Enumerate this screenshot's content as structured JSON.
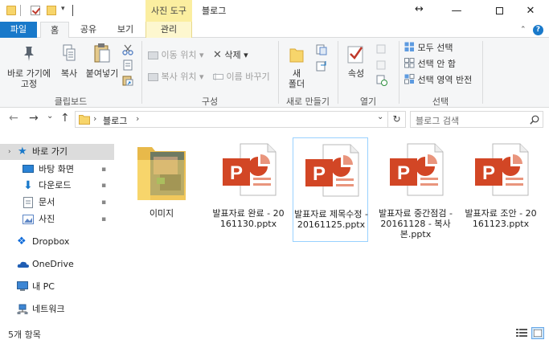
{
  "window": {
    "context_tab_header": "사진 도구",
    "title": "블로그",
    "resize_glyph": "↔",
    "minimize_glyph": "—",
    "close_glyph": "✕",
    "qa_dropdown_glyph": "▾"
  },
  "ribbon_tabs": [
    {
      "label": "파일"
    },
    {
      "label": "홈"
    },
    {
      "label": "공유"
    },
    {
      "label": "보기"
    },
    {
      "label": "관리"
    }
  ],
  "ribbon_collapse_glyph": "⌃",
  "help_glyph": "?",
  "ribbon": {
    "clipboard": {
      "label": "클립보드",
      "pin_line1": "바로 가기에",
      "pin_line2": "고정",
      "copy": "복사",
      "paste": "붙여넣기"
    },
    "organize": {
      "label": "구성",
      "move_to": "이동 위치 ▾",
      "copy_to": "복사 위치 ▾",
      "delete": "삭제 ▾",
      "rename": "이름 바꾸기"
    },
    "new": {
      "label": "새로 만들기",
      "new_folder_line1": "새",
      "new_folder_line2": "폴더"
    },
    "open": {
      "label": "열기",
      "properties": "속성"
    },
    "select": {
      "label": "선택",
      "select_all": "모두 선택",
      "select_none": "선택 안 함",
      "invert": "선택 영역 반전"
    }
  },
  "navbar": {
    "back_glyph": "←",
    "forward_glyph": "→",
    "dropdown_glyph": "⌄",
    "up_glyph": "↑",
    "breadcrumb_sep": "›",
    "breadcrumb": "블로그",
    "breadcrumb_chevron": "›",
    "address_dropdown_glyph": "⌄",
    "refresh_glyph": "↻",
    "search_placeholder": "블로그 검색"
  },
  "sidebar": {
    "items": [
      {
        "label": "바로 가기"
      },
      {
        "label": "바탕 화면",
        "pinned": true
      },
      {
        "label": "다운로드",
        "pinned": true
      },
      {
        "label": "문서",
        "pinned": true
      },
      {
        "label": "사진",
        "pinned": true
      },
      {
        "label": "Dropbox"
      },
      {
        "label": "OneDrive"
      },
      {
        "label": "내 PC"
      },
      {
        "label": "네트워크"
      }
    ],
    "pin_glyph": "📌"
  },
  "files": [
    {
      "name": "이미지",
      "type": "folder"
    },
    {
      "name": "발표자료 완료 - 20161130.pptx",
      "type": "pptx"
    },
    {
      "name": "발표자료 제목수정 - 20161125.pptx",
      "type": "pptx",
      "selected": true
    },
    {
      "name": "발표자료 중간점검 - 20161128 - 복사본.pptx",
      "type": "pptx"
    },
    {
      "name": "발표자료 조안 - 20161123.pptx",
      "type": "pptx"
    }
  ],
  "status": {
    "item_count": "5개 항목"
  },
  "colors": {
    "file_tab": "#1979ca",
    "context_tab": "#fbeea0",
    "ppt_orange": "#d24625",
    "folder_yellow": "#f7d56b",
    "selection_border": "#99d1ff"
  }
}
